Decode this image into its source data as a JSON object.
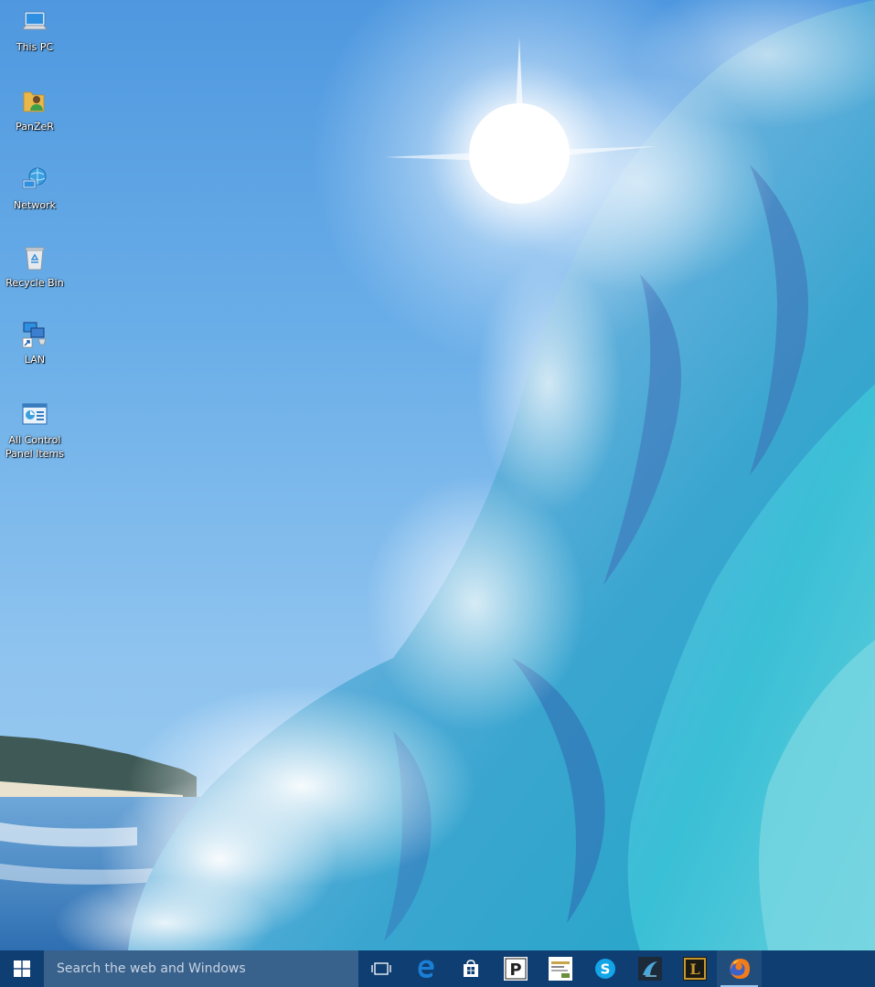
{
  "desktop": {
    "icons": [
      {
        "label": "This PC",
        "icon": "computer-icon"
      },
      {
        "label": "PanZeR",
        "icon": "user-folder-icon"
      },
      {
        "label": "Network",
        "icon": "network-icon"
      },
      {
        "label": "Recycle Bin",
        "icon": "recycle-bin-icon"
      },
      {
        "label": "LAN",
        "icon": "network-shortcut-icon"
      },
      {
        "label": "All Control Panel Items",
        "icon": "control-panel-icon"
      }
    ]
  },
  "taskbar": {
    "start_icon": "windows-logo-icon",
    "search_placeholder": "Search the web and Windows",
    "items": [
      {
        "icon": "task-view-icon"
      },
      {
        "icon": "edge-icon"
      },
      {
        "icon": "store-icon"
      },
      {
        "icon": "p-app-icon",
        "text": "P"
      },
      {
        "icon": "thumbnail-app-icon"
      },
      {
        "icon": "skype-icon",
        "text": "S"
      },
      {
        "icon": "dark-app-icon"
      },
      {
        "icon": "league-of-legends-icon",
        "text": "L"
      },
      {
        "icon": "firefox-icon",
        "active": true
      }
    ],
    "colors": {
      "taskbar_bg": "#0f3e72",
      "search_bg": "#38618c",
      "accent": "#1b7fd6"
    }
  }
}
